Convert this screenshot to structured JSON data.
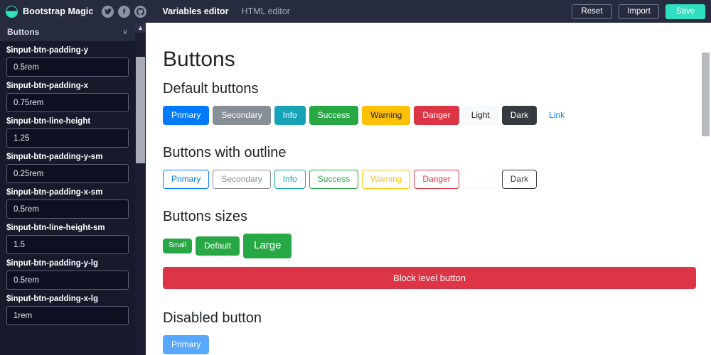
{
  "topbar": {
    "brand": "Bootstrap Magic",
    "logo_icon": "bootstrap-magic-logo",
    "socials": [
      {
        "name": "twitter-icon",
        "label": "Twitter"
      },
      {
        "name": "facebook-icon",
        "label": "Facebook"
      },
      {
        "name": "github-icon",
        "label": "GitHub"
      }
    ],
    "tabs": [
      {
        "label": "Variables editor",
        "active": true
      },
      {
        "label": "HTML editor",
        "active": false
      }
    ],
    "actions": {
      "reset": "Reset",
      "import": "Import",
      "save": "Save"
    },
    "colors": {
      "background": "#262b3e",
      "save_accent": "#2fe0c0",
      "logo_accent": "#2fe3b8"
    }
  },
  "sidebar": {
    "section_title": "Buttons",
    "collapse_icon": "chevron-down-icon",
    "scroll_up_icon": "caret-up-icon",
    "fields": [
      {
        "label": "$input-btn-padding-y",
        "value": "0.5rem"
      },
      {
        "label": "$input-btn-padding-x",
        "value": "0.75rem"
      },
      {
        "label": "$input-btn-line-height",
        "value": "1.25"
      },
      {
        "label": "$input-btn-padding-y-sm",
        "value": "0.25rem"
      },
      {
        "label": "$input-btn-padding-x-sm",
        "value": "0.5rem"
      },
      {
        "label": "$input-btn-line-height-sm",
        "value": "1.5"
      },
      {
        "label": "$input-btn-padding-y-lg",
        "value": "0.5rem"
      },
      {
        "label": "$input-btn-padding-x-lg",
        "value": "1rem"
      }
    ]
  },
  "main": {
    "page_title": "Buttons",
    "sections": {
      "default": {
        "title": "Default buttons",
        "buttons": [
          {
            "label": "Primary",
            "bg": "#007bff",
            "fg": "#ffffff",
            "border": "#007bff"
          },
          {
            "label": "Secondary",
            "bg": "#868e96",
            "fg": "#ffffff",
            "border": "#868e96"
          },
          {
            "label": "Info",
            "bg": "#17a2b8",
            "fg": "#ffffff",
            "border": "#17a2b8"
          },
          {
            "label": "Success",
            "bg": "#28a745",
            "fg": "#ffffff",
            "border": "#28a745"
          },
          {
            "label": "Warning",
            "bg": "#ffc107",
            "fg": "#212529",
            "border": "#ffc107"
          },
          {
            "label": "Danger",
            "bg": "#dc3545",
            "fg": "#ffffff",
            "border": "#dc3545"
          },
          {
            "label": "Light",
            "bg": "#f8f9fa",
            "fg": "#212529",
            "border": "#f8f9fa"
          },
          {
            "label": "Dark",
            "bg": "#343a40",
            "fg": "#ffffff",
            "border": "#343a40"
          },
          {
            "label": "Link",
            "bg": "transparent",
            "fg": "#007bff",
            "border": "transparent"
          }
        ]
      },
      "outline": {
        "title": "Buttons with outline",
        "buttons": [
          {
            "label": "Primary",
            "fg": "#007bff",
            "border": "#007bff"
          },
          {
            "label": "Secondary",
            "fg": "#868e96",
            "border": "#868e96"
          },
          {
            "label": "Info",
            "fg": "#17a2b8",
            "border": "#17a2b8"
          },
          {
            "label": "Success",
            "fg": "#28a745",
            "border": "#28a745"
          },
          {
            "label": "Warning",
            "fg": "#ffc107",
            "border": "#ffc107"
          },
          {
            "label": "Danger",
            "fg": "#dc3545",
            "border": "#dc3545"
          },
          {
            "label": "Light",
            "fg": "#f8f9fa",
            "border": "#f8f9fa"
          },
          {
            "label": "Dark",
            "fg": "#343a40",
            "border": "#343a40"
          }
        ]
      },
      "sizes": {
        "title": "Buttons sizes",
        "buttons": [
          {
            "label": "Small",
            "size": "sm",
            "bg": "#28a745",
            "fg": "#ffffff"
          },
          {
            "label": "Default",
            "size": "md",
            "bg": "#28a745",
            "fg": "#ffffff"
          },
          {
            "label": "Large",
            "size": "lg",
            "bg": "#28a745",
            "fg": "#ffffff"
          }
        ],
        "block_button": {
          "label": "Block level button",
          "bg": "#dc3545",
          "fg": "#ffffff"
        }
      },
      "disabled": {
        "title": "Disabled button",
        "button": {
          "label": "Primary",
          "bg": "#007bff",
          "fg": "#ffffff"
        }
      }
    }
  }
}
